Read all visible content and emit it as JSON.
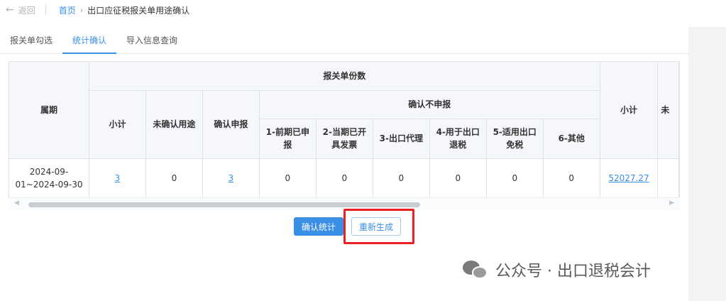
{
  "header": {
    "back_label": "返回",
    "breadcrumb_home": "首页",
    "breadcrumb_current": "出口应征税报关单用途确认"
  },
  "tabs": [
    {
      "label": "报关单勾选",
      "active": false
    },
    {
      "label": "统计确认",
      "active": true
    },
    {
      "label": "导入信息查询",
      "active": false
    }
  ],
  "table": {
    "headers": {
      "period": "属期",
      "declaration_count": "报关单份数",
      "subtotal": "小计",
      "unconfirmed_use": "未确认用途",
      "confirm_declare": "确认申报",
      "confirm_not_declare": "确认不申报",
      "nd_1": "1-前期已申报",
      "nd_2": "2-当期已开具发票",
      "nd_3": "3-出口代理",
      "nd_4": "4-用于出口退税",
      "nd_5": "5-适用出口免税",
      "nd_6": "6-其他",
      "subtotal2": "小计",
      "cut_partial": "未"
    },
    "rows": [
      {
        "period": "2024-09-01~2024-09-30",
        "subtotal": "3",
        "unconfirmed_use": "0",
        "confirm_declare": "3",
        "nd_1": "0",
        "nd_2": "0",
        "nd_3": "0",
        "nd_4": "0",
        "nd_5": "0",
        "nd_6": "0",
        "subtotal2": "52027.27"
      }
    ]
  },
  "buttons": {
    "confirm_stats": "确认统计",
    "regenerate": "重新生成"
  },
  "watermark": {
    "text": "公众号 · 出口退税会计"
  },
  "colors": {
    "accent": "#3a8ee6",
    "highlight": "#e8201f"
  }
}
